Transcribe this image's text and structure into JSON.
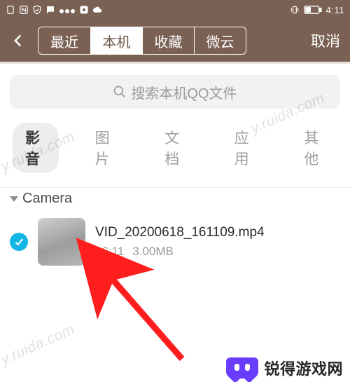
{
  "status": {
    "time": "4:11"
  },
  "header": {
    "tabs": [
      {
        "label": "最近"
      },
      {
        "label": "本机"
      },
      {
        "label": "收藏"
      },
      {
        "label": "微云"
      }
    ],
    "active_tab_index": 1,
    "cancel_label": "取消"
  },
  "search": {
    "placeholder": "搜索本机QQ文件"
  },
  "categories": {
    "items": [
      {
        "label": "影音"
      },
      {
        "label": "图片"
      },
      {
        "label": "文档"
      },
      {
        "label": "应用"
      },
      {
        "label": "其他"
      }
    ],
    "active_index": 0
  },
  "section": {
    "title": "Camera",
    "expanded": true
  },
  "files": [
    {
      "selected": true,
      "name": "VID_20200618_161109.mp4",
      "time": "16:11",
      "size": "3.00MB"
    }
  ],
  "branding": {
    "watermark_text": "y.ruida.com",
    "logo_text": "锐得游戏网"
  }
}
